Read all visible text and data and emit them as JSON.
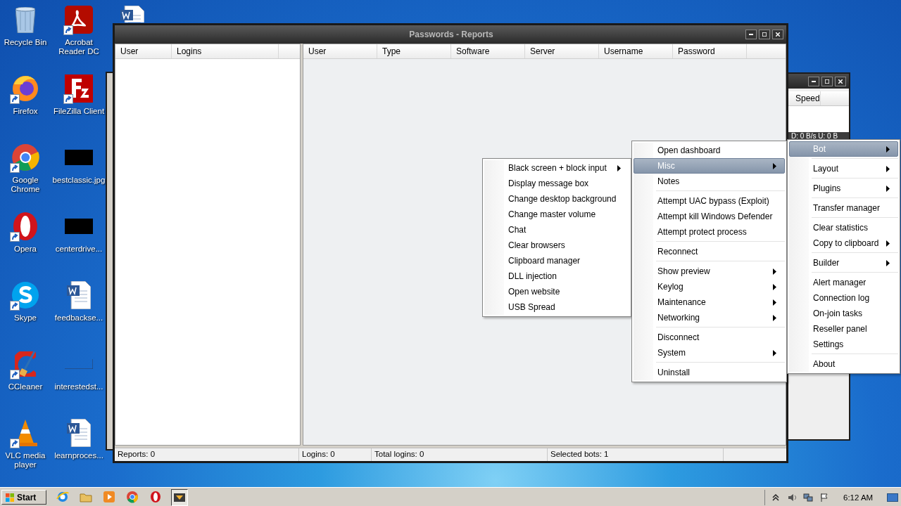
{
  "desktop": {
    "icons": [
      {
        "label": "Recycle Bin",
        "kind": "bin",
        "shortcut": false
      },
      {
        "label": "Firefox",
        "kind": "firefox",
        "shortcut": true
      },
      {
        "label": "Google Chrome",
        "kind": "chrome",
        "shortcut": true
      },
      {
        "label": "Opera",
        "kind": "opera",
        "shortcut": true
      },
      {
        "label": "Skype",
        "kind": "skype",
        "shortcut": true
      },
      {
        "label": "CCleaner",
        "kind": "ccleaner",
        "shortcut": true
      },
      {
        "label": "VLC media player",
        "kind": "vlc",
        "shortcut": true
      },
      {
        "label": "Acrobat Reader DC",
        "kind": "pdf",
        "shortcut": true
      },
      {
        "label": "FileZilla Client",
        "kind": "filezilla",
        "shortcut": true
      },
      {
        "label": "bestclassic.jpg",
        "kind": "image",
        "shortcut": false
      },
      {
        "label": "centerdrive...",
        "kind": "image",
        "shortcut": false
      },
      {
        "label": "feedbackse...",
        "kind": "document",
        "shortcut": false
      },
      {
        "label": "interestedst...",
        "kind": "blank",
        "shortcut": false
      },
      {
        "label": "learnproces...",
        "kind": "document",
        "shortcut": false
      },
      {
        "kind": "document",
        "shortcut": false
      }
    ]
  },
  "back_window": {
    "columns": [
      "Speed"
    ],
    "status": "D: 0 B/s U: 0 B"
  },
  "window": {
    "title": "Passwords - Reports",
    "left_table": {
      "columns": [
        "User",
        "Logins"
      ]
    },
    "right_table": {
      "columns": [
        "User",
        "Type",
        "Software",
        "Server",
        "Username",
        "Password"
      ]
    },
    "status_bar": [
      "Reports: 0",
      "Logins: 0",
      "Total logins: 0",
      "Selected bots: 1"
    ]
  },
  "menus": [
    {
      "items": [
        {
          "kind": "item",
          "label": "Black screen + block input",
          "submenu": true,
          "selected": false
        },
        {
          "kind": "item",
          "label": "Display message box",
          "submenu": false,
          "selected": false
        },
        {
          "kind": "item",
          "label": "Change desktop background",
          "submenu": false,
          "selected": false
        },
        {
          "kind": "item",
          "label": "Change master volume",
          "submenu": false,
          "selected": false
        },
        {
          "kind": "item",
          "label": "Chat",
          "submenu": false,
          "selected": false
        },
        {
          "kind": "item",
          "label": "Clear browsers",
          "submenu": false,
          "selected": false
        },
        {
          "kind": "item",
          "label": "Clipboard manager",
          "submenu": false,
          "selected": false
        },
        {
          "kind": "item",
          "label": "DLL injection",
          "submenu": false,
          "selected": false
        },
        {
          "kind": "item",
          "label": "Open website",
          "submenu": false,
          "selected": false
        },
        {
          "kind": "item",
          "label": "USB Spread",
          "submenu": false,
          "selected": false
        }
      ]
    },
    {
      "items": [
        {
          "kind": "item",
          "label": "Open dashboard",
          "submenu": false,
          "selected": false
        },
        {
          "kind": "item",
          "label": "Misc",
          "submenu": true,
          "selected": true
        },
        {
          "kind": "item",
          "label": "Notes",
          "submenu": false,
          "selected": false
        },
        {
          "kind": "separator"
        },
        {
          "kind": "item",
          "label": "Attempt UAC bypass (Exploit)",
          "submenu": false,
          "selected": false
        },
        {
          "kind": "item",
          "label": "Attempt kill Windows Defender",
          "submenu": false,
          "selected": false
        },
        {
          "kind": "item",
          "label": "Attempt protect process",
          "submenu": false,
          "selected": false
        },
        {
          "kind": "separator"
        },
        {
          "kind": "item",
          "label": "Reconnect",
          "submenu": false,
          "selected": false
        },
        {
          "kind": "separator"
        },
        {
          "kind": "item",
          "label": "Show preview",
          "submenu": true,
          "selected": false
        },
        {
          "kind": "item",
          "label": "Keylog",
          "submenu": true,
          "selected": false
        },
        {
          "kind": "item",
          "label": "Maintenance",
          "submenu": true,
          "selected": false
        },
        {
          "kind": "item",
          "label": "Networking",
          "submenu": true,
          "selected": false
        },
        {
          "kind": "separator"
        },
        {
          "kind": "item",
          "label": "Disconnect",
          "submenu": false,
          "selected": false
        },
        {
          "kind": "item",
          "label": "System",
          "submenu": true,
          "selected": false
        },
        {
          "kind": "separator"
        },
        {
          "kind": "item",
          "label": "Uninstall",
          "submenu": false,
          "selected": false
        }
      ]
    },
    {
      "items": [
        {
          "kind": "item",
          "label": "Bot",
          "submenu": true,
          "selected": true
        },
        {
          "kind": "separator"
        },
        {
          "kind": "item",
          "label": "Layout",
          "submenu": true,
          "selected": false
        },
        {
          "kind": "separator"
        },
        {
          "kind": "item",
          "label": "Plugins",
          "submenu": true,
          "selected": false
        },
        {
          "kind": "separator"
        },
        {
          "kind": "item",
          "label": "Transfer manager",
          "submenu": false,
          "selected": false
        },
        {
          "kind": "separator"
        },
        {
          "kind": "item",
          "label": "Clear statistics",
          "submenu": false,
          "selected": false
        },
        {
          "kind": "item",
          "label": "Copy to clipboard",
          "submenu": true,
          "selected": false
        },
        {
          "kind": "separator"
        },
        {
          "kind": "item",
          "label": "Builder",
          "submenu": true,
          "selected": false
        },
        {
          "kind": "separator"
        },
        {
          "kind": "item",
          "label": "Alert manager",
          "submenu": false,
          "selected": false
        },
        {
          "kind": "item",
          "label": "Connection log",
          "submenu": false,
          "selected": false
        },
        {
          "kind": "item",
          "label": "On-join tasks",
          "submenu": false,
          "selected": false
        },
        {
          "kind": "item",
          "label": "Reseller panel",
          "submenu": false,
          "selected": false
        },
        {
          "kind": "item",
          "label": "Settings",
          "submenu": false,
          "selected": false
        },
        {
          "kind": "separator"
        },
        {
          "kind": "item",
          "label": "About",
          "submenu": false,
          "selected": false
        }
      ]
    }
  ],
  "taskbar": {
    "start": "Start",
    "clock": "6:12 AM"
  }
}
